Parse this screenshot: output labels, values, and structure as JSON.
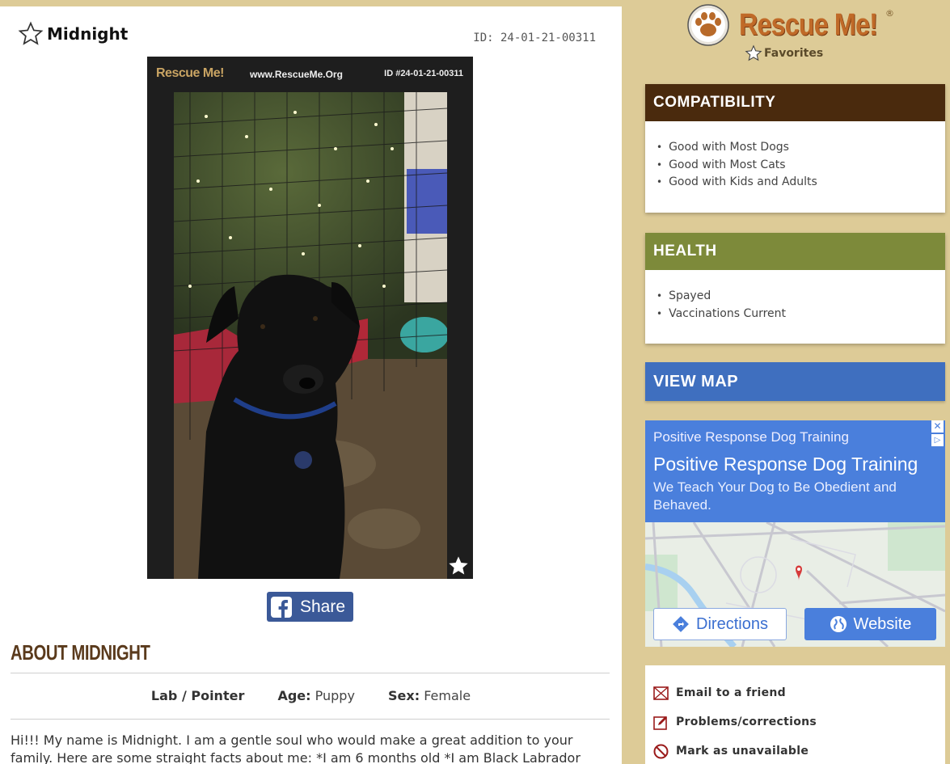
{
  "pet": {
    "name": "Midnight",
    "id_label": "ID: 24-01-21-00311"
  },
  "photo": {
    "brand": "Rescue Me!",
    "url": "www.RescueMe.Org",
    "id": "ID #24-01-21-00311"
  },
  "share": {
    "label": "Share"
  },
  "about": {
    "heading": "ABOUT MIDNIGHT",
    "breed": "Lab / Pointer",
    "age_label": "Age:",
    "age": "Puppy",
    "sex_label": "Sex:",
    "sex": "Female",
    "description": "Hi!!! My name is Midnight. I am a gentle soul who would make a great addition to your family. Here are some straight facts about me: *I am 6 months old *I am Black Labrador"
  },
  "sidebar": {
    "logo": "Rescue Me!",
    "logo_reg": "®",
    "favorites": "Favorites",
    "compatibility": {
      "title": "COMPATIBILITY",
      "items": [
        "Good with Most Dogs",
        "Good with Most Cats",
        "Good with Kids and Adults"
      ]
    },
    "health": {
      "title": "HEALTH",
      "items": [
        "Spayed",
        "Vaccinations Current"
      ]
    },
    "view_map": "VIEW MAP",
    "ad": {
      "small_title": "Positive Response Dog Training",
      "big_title": "Positive Response Dog Training",
      "description": "We Teach Your Dog to Be Obedient and Behaved.",
      "close": "✕",
      "info": "▷",
      "directions": "Directions",
      "website": "Website"
    },
    "actions": {
      "email": "Email to a friend",
      "problems": "Problems/corrections",
      "unavailable": "Mark as unavailable"
    }
  },
  "colors": {
    "background": "#ddcb97",
    "compatibility_header": "#4a2a0d",
    "health_header": "#7d8a3a",
    "view_map": "#3f6fbf",
    "brand_orange": "#c06a28",
    "facebook": "#3b5998"
  }
}
